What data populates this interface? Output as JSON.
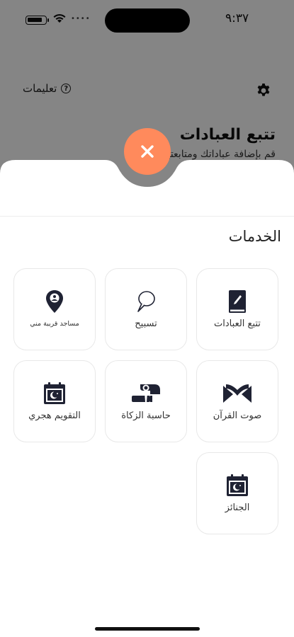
{
  "status": {
    "time": "٩:٣٧"
  },
  "background": {
    "instructions_label": "تعليمات",
    "title": "تتبع العبادات",
    "subtitle": "قم بإضافة عباداتك ومتابعتها"
  },
  "sheet": {
    "section_title": "الخدمات",
    "accent_color": "#ff8a5c",
    "services": [
      {
        "label": "تتبع العبادات",
        "icon": "notebook-icon"
      },
      {
        "label": "تسبيح",
        "icon": "speech-bubble-icon"
      },
      {
        "label": "مساجد قريبة مني",
        "icon": "location-pin-icon"
      },
      {
        "label": "صوت القرآن",
        "icon": "quran-book-icon"
      },
      {
        "label": "حاسبة الزكاة",
        "icon": "zakat-hand-icon"
      },
      {
        "label": "التقويم هجري",
        "icon": "calendar-moon-icon"
      },
      {
        "label": "الجنائز",
        "icon": "calendar-moon-icon"
      }
    ]
  }
}
